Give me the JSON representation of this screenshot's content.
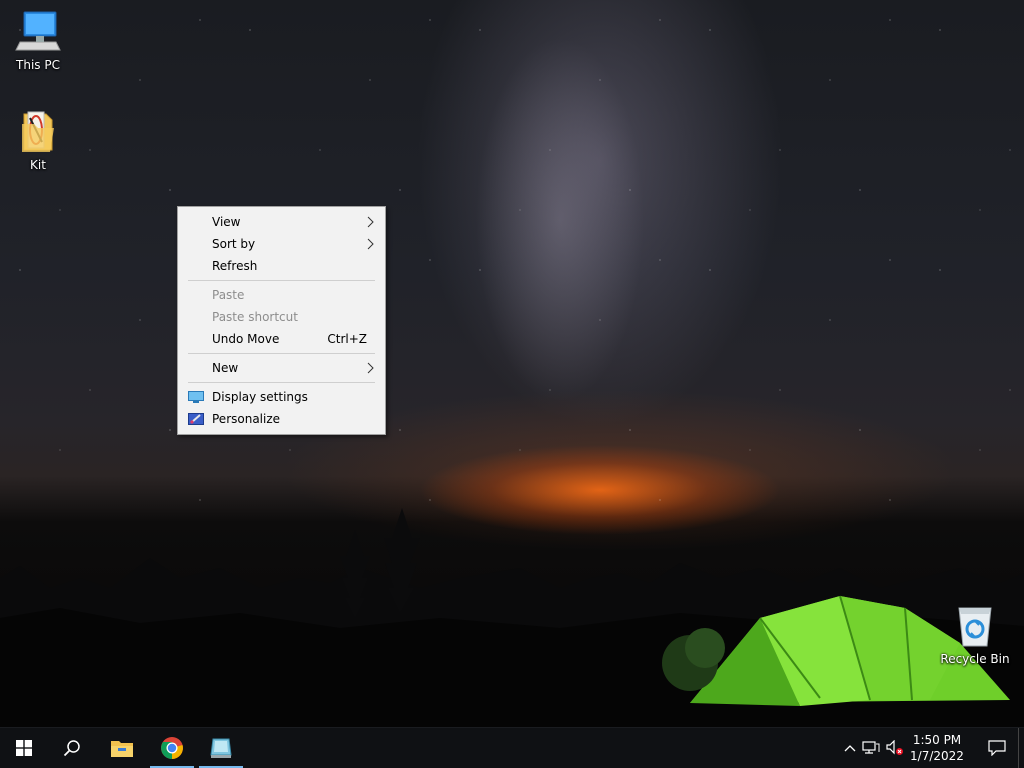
{
  "desktop": {
    "icons": [
      {
        "label": "This PC",
        "icon": "this-pc-icon"
      },
      {
        "label": "Kit",
        "icon": "folder-icon"
      },
      {
        "label": "Recycle Bin",
        "icon": "recycle-bin-icon"
      }
    ]
  },
  "context_menu": {
    "items": {
      "view": {
        "label": "View",
        "has_submenu": true,
        "enabled": true
      },
      "sort_by": {
        "label": "Sort by",
        "has_submenu": true,
        "enabled": true
      },
      "refresh": {
        "label": "Refresh",
        "enabled": true
      },
      "paste": {
        "label": "Paste",
        "enabled": false
      },
      "paste_shortcut": {
        "label": "Paste shortcut",
        "enabled": false
      },
      "undo_move": {
        "label": "Undo Move",
        "shortcut": "Ctrl+Z",
        "enabled": true
      },
      "new": {
        "label": "New",
        "has_submenu": true,
        "enabled": true
      },
      "display_settings": {
        "label": "Display settings",
        "icon": "display-icon",
        "enabled": true
      },
      "personalize": {
        "label": "Personalize",
        "icon": "personalize-icon",
        "enabled": true
      }
    }
  },
  "taskbar": {
    "buttons": [
      {
        "name": "start",
        "icon": "windows-logo-icon"
      },
      {
        "name": "search",
        "icon": "search-icon"
      },
      {
        "name": "file-explorer",
        "icon": "file-explorer-icon"
      },
      {
        "name": "chrome",
        "icon": "chrome-icon",
        "active": true
      },
      {
        "name": "app",
        "icon": "app-icon",
        "active": true
      }
    ],
    "tray": {
      "icons": [
        "chevron-up-icon",
        "network-icon",
        "volume-muted-icon"
      ],
      "time": "1:50 PM",
      "date": "1/7/2022",
      "notification_icon": "action-center-icon"
    },
    "accent_color": "#76b9ed"
  }
}
